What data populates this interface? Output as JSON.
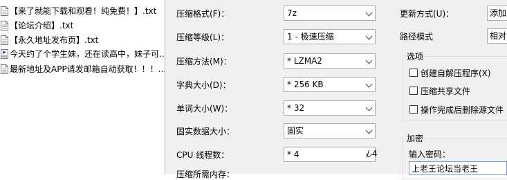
{
  "files": [
    {
      "name": "【来了就能下载和观看！纯免费！】.txt",
      "icon": "text-file-icon"
    },
    {
      "name": "【论坛介绍】.txt",
      "icon": "text-file-icon"
    },
    {
      "name": "【永久地址发布页】.txt",
      "icon": "text-file-icon"
    },
    {
      "name": "今天约了个学生妹，还在读高中，妹子可...",
      "icon": "mp4-file-icon",
      "icon_text": "MP4"
    },
    {
      "name": "最新地址及APP请发邮箱自动获取！！！...",
      "icon": "text-file-icon"
    }
  ],
  "form": {
    "format_label": "压缩格式(F)：",
    "format_value": "7z",
    "level_label": "压缩等级(L)：",
    "level_value": "1 - 极速压缩",
    "method_label": "压缩方法(M)：",
    "method_value": "* LZMA2",
    "dict_label": "字典大小(D)：",
    "dict_value": "* 256 KB",
    "word_label": "单词大小(W)：",
    "word_value": "* 32",
    "solid_label": "固实数据大小：",
    "solid_value": "固实",
    "threads_label": "CPU 线程数：",
    "threads_value": "* 4",
    "threads_total": "/ 4",
    "memory_label": "压缩所需内存："
  },
  "right": {
    "update_label": "更新方式(U)：",
    "update_value": "添加",
    "path_label": "路径模式",
    "path_value": "相对",
    "options_title": "选项",
    "options": [
      {
        "label": "创建自解压程序(X)",
        "checked": false
      },
      {
        "label": "压缩共享文件",
        "checked": false
      },
      {
        "label": "操作完成后删除源文件",
        "checked": false
      }
    ],
    "encrypt_title": "加密",
    "password_label": "输入密码：",
    "password_value": "上老王论坛当老王"
  },
  "colors": {
    "dialog_bg": "#f0f0f0",
    "field_border": "#abadb3",
    "mp4_icon": "#6a3fb0"
  }
}
